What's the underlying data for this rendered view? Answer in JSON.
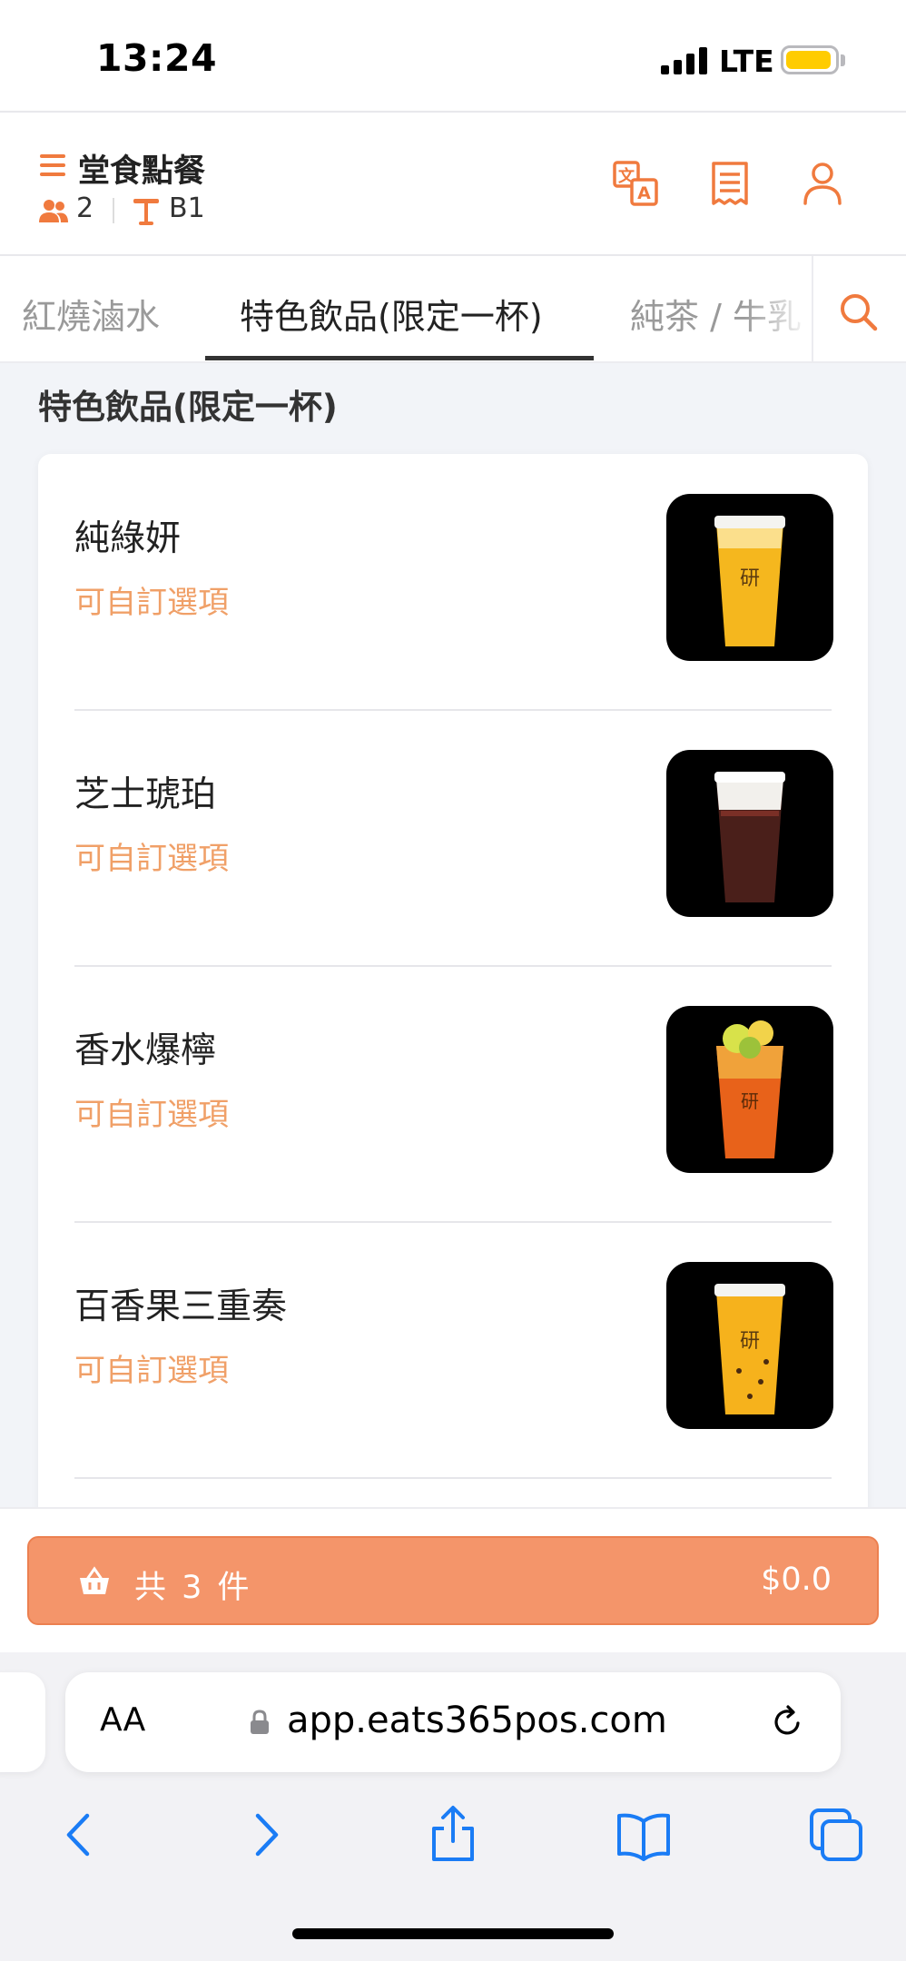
{
  "status_bar": {
    "time": "13:24",
    "network": "LTE"
  },
  "header": {
    "title": "堂食點餐",
    "guest_count": "2",
    "table": "B1"
  },
  "tabs": [
    {
      "label": "紅燒滷水"
    },
    {
      "label": "特色飲品(限定一杯)"
    },
    {
      "label": "純茶 / 牛乳"
    }
  ],
  "section": {
    "title": "特色飲品(限定一杯)"
  },
  "items": [
    {
      "name": "純綠妍",
      "option": "可自訂選項",
      "drink_color": "#f5b71e"
    },
    {
      "name": "芝士琥珀",
      "option": "可自訂選項",
      "drink_color": "#4a1f1a"
    },
    {
      "name": "香水爆檸",
      "option": "可自訂選項",
      "drink_color": "#e8621a"
    },
    {
      "name": "百香果三重奏",
      "option": "可自訂選項",
      "drink_color": "#f6b21c"
    }
  ],
  "cart": {
    "count_label": "共 3 件",
    "total": "$0.0"
  },
  "browser": {
    "aa_label": "AA",
    "url": "app.eats365pos.com"
  },
  "colors": {
    "accent": "#f07a3e",
    "cart_bg": "#f4956a",
    "option_text": "#f0a068",
    "safari_blue": "#1a7cf5"
  },
  "icons": [
    "menu-icon",
    "guests-icon",
    "table-icon",
    "translate-icon",
    "receipt-icon",
    "user-icon",
    "search-icon",
    "basket-icon",
    "lock-icon",
    "reload-icon",
    "back-icon",
    "forward-icon",
    "share-icon",
    "bookmarks-icon",
    "tabs-icon"
  ]
}
